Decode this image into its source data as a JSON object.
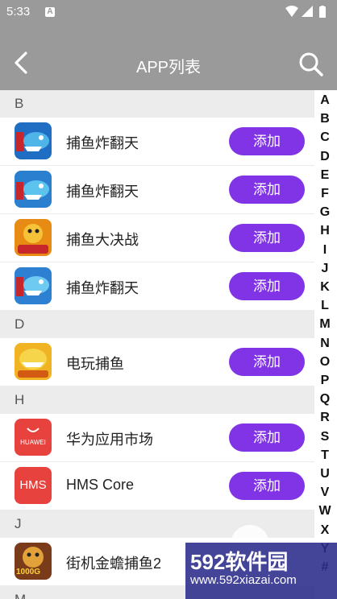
{
  "status_bar": {
    "time": "5:33",
    "notification_badge": "A"
  },
  "toolbar": {
    "title": "APP列表"
  },
  "sections": [
    {
      "letter": "B",
      "apps": [
        {
          "name": "捕鱼炸翻天",
          "icon": "fish-game-icon-blue"
        },
        {
          "name": "捕鱼炸翻天",
          "icon": "fish-game-icon-blue"
        },
        {
          "name": "捕鱼大决战",
          "icon": "fish-game-icon-orange"
        },
        {
          "name": "捕鱼炸翻天",
          "icon": "fish-game-icon-blue"
        }
      ]
    },
    {
      "letter": "D",
      "apps": [
        {
          "name": "电玩捕鱼",
          "icon": "fish-game-icon-gold"
        }
      ]
    },
    {
      "letter": "H",
      "apps": [
        {
          "name": "华为应用市场",
          "icon": "huawei-appgallery-icon"
        },
        {
          "name": "HMS Core",
          "icon": "hms-core-icon"
        }
      ]
    },
    {
      "letter": "J",
      "apps": [
        {
          "name": "街机金蟾捕鱼2",
          "icon": "fish-game-icon-1000g"
        }
      ]
    },
    {
      "letter": "M",
      "apps": []
    }
  ],
  "add_button_label": "添加",
  "huawei_label": "HUAWEI",
  "hms_label": "HMS",
  "jackpot_label": "1000G",
  "index_letters": [
    "A",
    "B",
    "C",
    "D",
    "E",
    "F",
    "G",
    "H",
    "I",
    "J",
    "K",
    "L",
    "M",
    "N",
    "O",
    "P",
    "Q",
    "R",
    "S",
    "T",
    "U",
    "V",
    "W",
    "X",
    "Y",
    "#"
  ],
  "watermark": {
    "brand": "592软件园",
    "url": "www.592xiazai.com"
  },
  "colors": {
    "accent": "#8134e6",
    "toolbar": "#9a9a9a",
    "section_bg": "#ececec"
  }
}
